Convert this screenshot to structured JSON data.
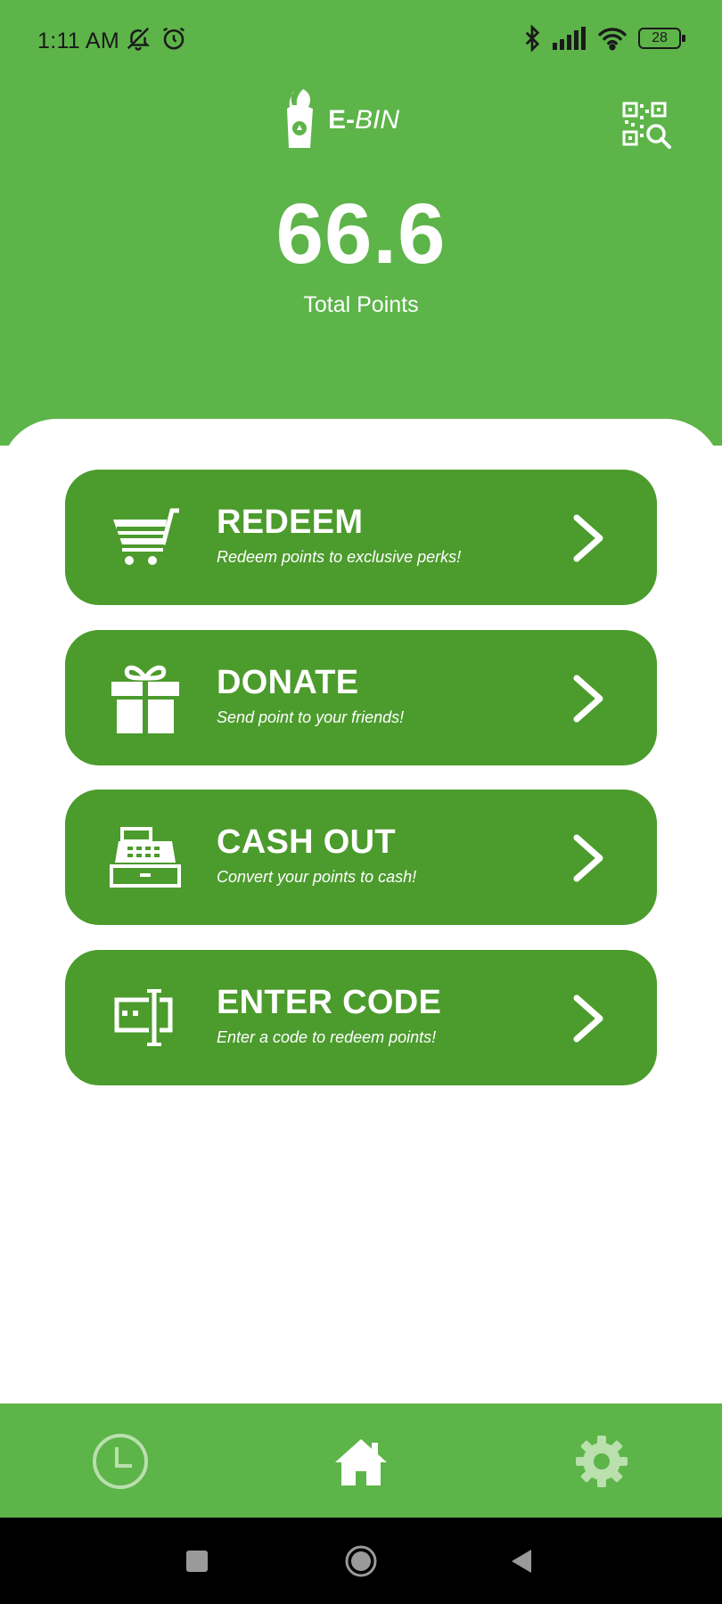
{
  "status_bar": {
    "time": "1:11 AM",
    "battery": "28",
    "left_icons": [
      "bell-off-icon",
      "alarm-icon"
    ],
    "right_icons": [
      "bluetooth-icon",
      "signal-icon",
      "wifi-icon",
      "battery-icon"
    ]
  },
  "header": {
    "logo_bold": "E-",
    "logo_italic": "BIN",
    "qr_icon": "qr-scan-icon"
  },
  "points": {
    "value": "66.6",
    "label": "Total Points"
  },
  "actions": [
    {
      "title": "REDEEM",
      "subtitle": "Redeem points to exclusive perks!",
      "icon": "cart-icon"
    },
    {
      "title": "DONATE",
      "subtitle": "Send point to your friends!",
      "icon": "gift-icon"
    },
    {
      "title": "CASH OUT",
      "subtitle": "Convert your points to cash!",
      "icon": "cash-register-icon"
    },
    {
      "title": "ENTER CODE",
      "subtitle": "Enter a code to redeem points!",
      "icon": "code-entry-icon"
    }
  ],
  "nav": {
    "items": [
      "history-clock-icon",
      "home-icon",
      "settings-gear-icon"
    ],
    "active": "home-icon"
  },
  "system_nav": [
    "recents-square-icon",
    "home-circle-icon",
    "back-triangle-icon"
  ],
  "colors": {
    "header_green": "#5db449",
    "card_green": "#4c9b2d",
    "text_white": "#ffffff"
  }
}
